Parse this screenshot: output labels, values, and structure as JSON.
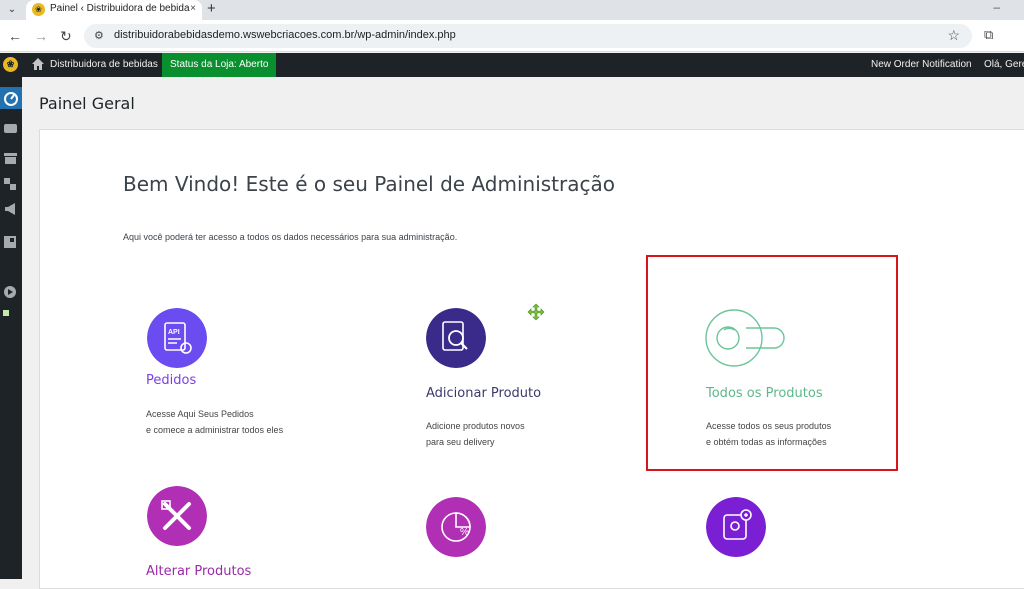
{
  "browser": {
    "tab_title": "Painel ‹ Distribuidora de bebidas",
    "tab_close": "×",
    "new_tab": "+",
    "url": "distribuidorabebidasdemo.wswebcriacoes.com.br/wp-admin/index.php"
  },
  "adminbar": {
    "site_name": "Distribuidora de bebidas",
    "store_status": "Status da Loja: Aberto",
    "order_notification": "New Order Notification",
    "greeting": "Olá, Gere"
  },
  "page": {
    "heading": "Painel Geral",
    "welcome_title": "Bem Vindo! Este é o seu Painel de Administração",
    "welcome_subtitle": "Aqui você poderá ter acesso a todos os dados necessários para sua administração."
  },
  "cards": [
    {
      "title": "Pedidos",
      "desc_line1": "Acesse Aqui Seus Pedidos",
      "desc_line2": "e comece a administrar todos eles",
      "color": "#7b3fe4"
    },
    {
      "title": "Adicionar Produto",
      "desc_line1": "Adicione produtos novos",
      "desc_line2": "para seu delivery",
      "color": "#3a2a8a"
    },
    {
      "title": "Todos os Produtos",
      "desc_line1": "Acesse todos os seus produtos",
      "desc_line2": "e obtém todas as informações",
      "color": "#5cb88a"
    },
    {
      "title": "Alterar Produtos",
      "color": "#b12fb5"
    },
    {
      "title": "",
      "color": "#b12fb5"
    },
    {
      "title": "",
      "color": "#7b1fd4"
    }
  ],
  "colors": {
    "adminbar_bg": "#1d2327",
    "store_status_bg": "#0a8f2f",
    "highlight_border": "#d9141a",
    "sidebar_active": "#2271b1"
  }
}
